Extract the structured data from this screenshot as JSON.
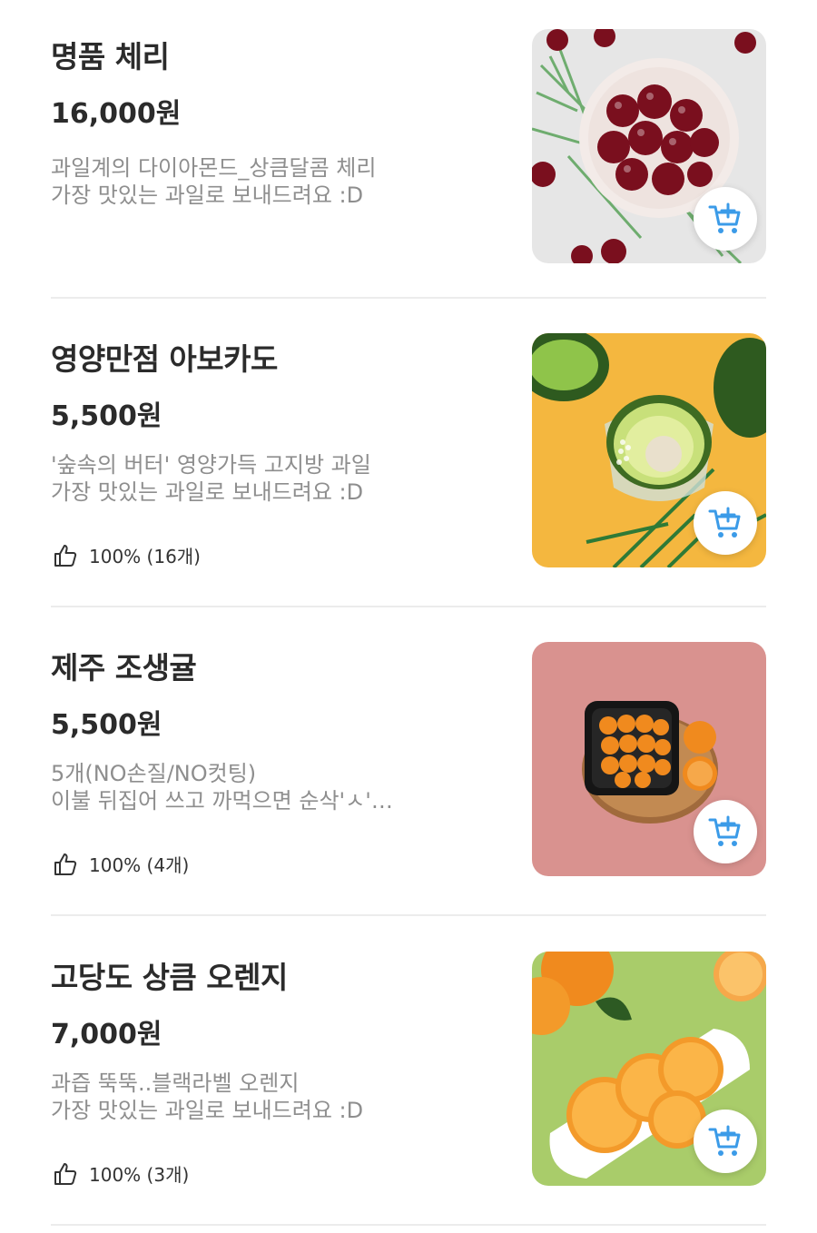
{
  "products": [
    {
      "name": "명품 체리",
      "price": "16,000원",
      "desc_line1": "과일계의 다이아몬드_상큼달콤 체리",
      "desc_line2": "가장 맛있는 과일로 보내드려요 :D",
      "rating": "",
      "image_icon": "cherry-bowl",
      "bg_color": "#e6e6e6"
    },
    {
      "name": "영양만점 아보카도",
      "price": "5,500원",
      "desc_line1": "'숲속의 버터' 영양가득 고지방 과일",
      "desc_line2": "가장 맛있는 과일로 보내드려요 :D",
      "rating": "100% (16개)",
      "image_icon": "avocado-bowl",
      "bg_color": "#f4b73f"
    },
    {
      "name": "제주 조생귤",
      "price": "5,500원",
      "desc_line1": "5개(NO손질/NO컷팅)",
      "desc_line2": "이불 뒤집어 쓰고 까먹으면 순삭'ㅅ'…",
      "rating": "100% (4개)",
      "image_icon": "tangerine-box",
      "bg_color": "#d9928f"
    },
    {
      "name": "고당도 상큼 오렌지",
      "price": "7,000원",
      "desc_line1": "과즙 뚝뚝..블랙라벨 오렌지",
      "desc_line2": "가장 맛있는 과일로 보내드려요 :D",
      "rating": "100% (3개)",
      "image_icon": "orange-slices-plate",
      "bg_color": "#a9cc6a"
    }
  ],
  "colors": {
    "cart_icon": "#3b9be8",
    "divider": "#ececec",
    "desc_text": "#8e8e8e"
  }
}
